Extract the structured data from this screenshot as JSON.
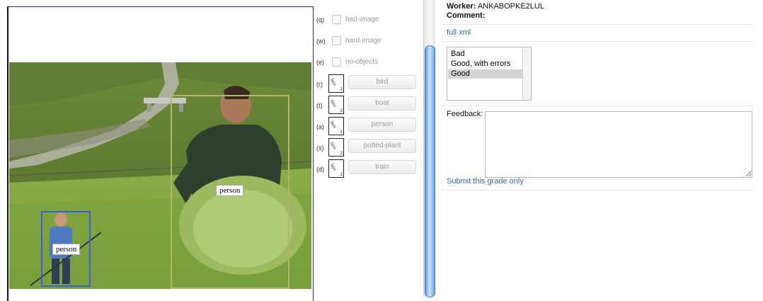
{
  "image": {
    "bboxes": [
      {
        "label": "person"
      },
      {
        "label": "person"
      }
    ]
  },
  "options": {
    "flags": [
      {
        "key": "(q)",
        "label": "bad-image"
      },
      {
        "key": "(w)",
        "label": "hard-image"
      },
      {
        "key": "(e)",
        "label": "no-objects"
      }
    ],
    "classes": [
      {
        "key": "(r)",
        "label": "bird"
      },
      {
        "key": "(t)",
        "label": "boat"
      },
      {
        "key": "(a)",
        "label": "person"
      },
      {
        "key": "(s)",
        "label": "potted-plant"
      },
      {
        "key": "(d)",
        "label": "train"
      }
    ],
    "box_icon_text": "box",
    "box_icon_sub": "2"
  },
  "panel": {
    "worker_label": "Worker:",
    "worker_value": "ANKABOPKE2LUL",
    "comment_label": "Comment:",
    "full_xml_link": "full xml",
    "grades": [
      "Bad",
      "Good, with errors",
      "Good"
    ],
    "selected_grade": "Good",
    "feedback_label": "Feedback:",
    "feedback_value": "",
    "submit_link": "Submit this grade only"
  }
}
